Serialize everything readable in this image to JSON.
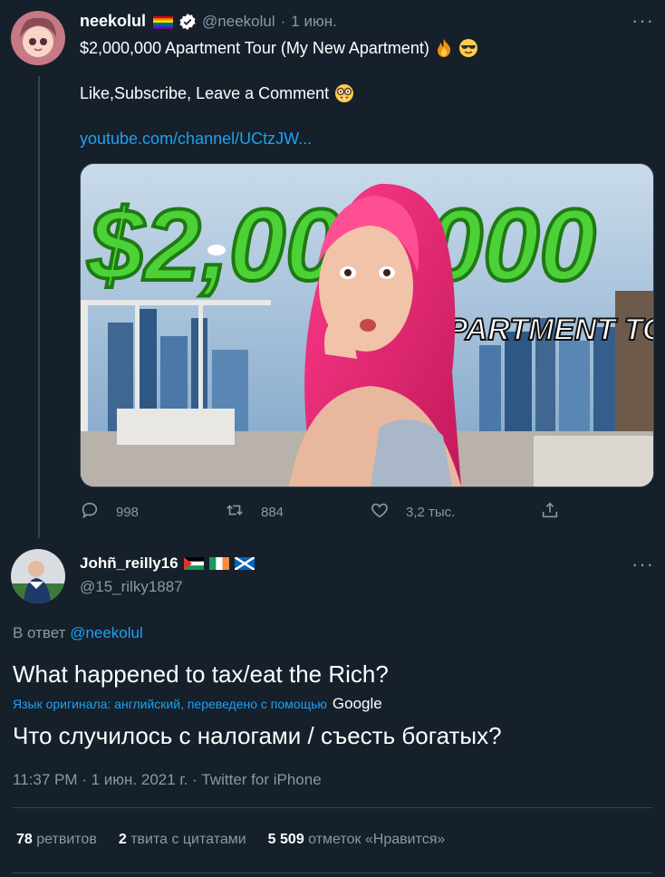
{
  "tweet": {
    "author_name": "neekolul",
    "handle": "@neekolul",
    "separator": "·",
    "date": "1 июн.",
    "line1": "$2,000,000 Apartment Tour (My New Apartment)",
    "line2": "Like,Subscribe, Leave a Comment",
    "link": "youtube.com/channel/UCtzJW...",
    "thumbnail": {
      "big_text": "$2,000,000",
      "banner_text": "APARTMENT TOUR"
    },
    "actions": {
      "replies": "998",
      "retweets": "884",
      "likes": "3,2 тыс."
    }
  },
  "reply": {
    "author_name": "Johñ_reilly16",
    "handle": "@15_rilky1887",
    "replying_prefix": "В ответ",
    "replying_to": "@neekolul",
    "text": "What happened to tax/eat the Rich?",
    "translation_note": "Язык оригинала: английский, переведено с помощью",
    "translation_provider": "Google",
    "translated_text": "Что случилось с налогами / съесть богатых?",
    "timestamp": "11:37 PM · 1 июн. 2021 г. · Twitter for iPhone",
    "stats": {
      "retweets_count": "78",
      "retweets_label": "ретвитов",
      "quotes_count": "2",
      "quotes_label": "твита с цитатами",
      "likes_count": "5 509",
      "likes_label": "отметок «Нравится»"
    }
  },
  "colors": {
    "background": "#15202b",
    "link": "#1da1f2",
    "muted": "#8899a6",
    "verified": "#ffffff"
  },
  "icons": [
    "more-dots-icon",
    "verified-icon",
    "reply-icon",
    "retweet-icon",
    "like-icon",
    "share-icon",
    "pride-flag-icon",
    "fire-emoji-icon",
    "sunglasses-emoji-icon",
    "nerd-emoji-icon"
  ]
}
